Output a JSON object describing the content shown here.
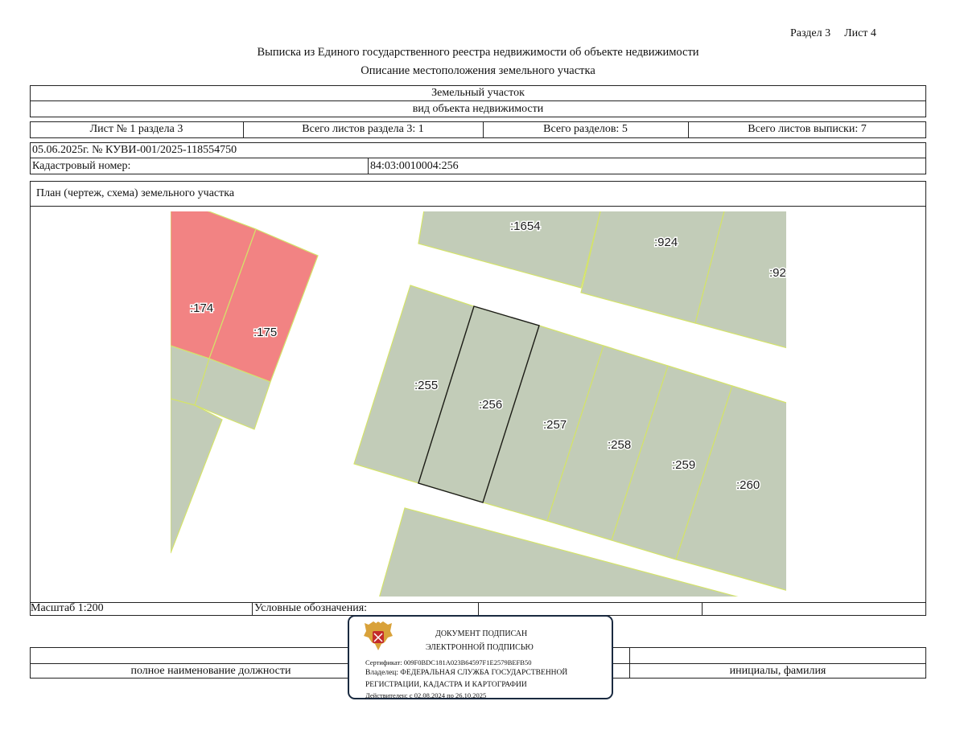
{
  "header": {
    "section": "Раздел 3",
    "sheet": "Лист 4",
    "title": "Выписка из Единого государственного реестра недвижимости об объекте недвижимости",
    "subtitle": "Описание местоположения земельного участка"
  },
  "object": {
    "type": "Земельный участок",
    "type_caption": "вид объекта недвижимости"
  },
  "sheets_row": {
    "sheet_no": "Лист № 1 раздела 3",
    "total_section_sheets": "Всего листов раздела 3: 1",
    "total_sections": "Всего разделов: 5",
    "total_extract_sheets": "Всего листов выписки: 7"
  },
  "record": {
    "date_number": "05.06.2025г. № КУВИ-001/2025-118554750",
    "cadastral_label": "Кадастровый номер:",
    "cadastral_value": "84:03:0010004:256"
  },
  "plan": {
    "title": "План (чертеж, схема) земельного участка",
    "parcels": [
      {
        "label": ":1654",
        "kind": "neighbor"
      },
      {
        "label": ":924",
        "kind": "neighbor"
      },
      {
        "label": ":92",
        "kind": "neighbor"
      },
      {
        "label": ":174",
        "kind": "highlighted"
      },
      {
        "label": ":175",
        "kind": "highlighted"
      },
      {
        "label": ":255",
        "kind": "neighbor"
      },
      {
        "label": ":256",
        "kind": "subject"
      },
      {
        "label": ":257",
        "kind": "neighbor"
      },
      {
        "label": ":258",
        "kind": "neighbor"
      },
      {
        "label": ":259",
        "kind": "neighbor"
      },
      {
        "label": ":260",
        "kind": "neighbor"
      }
    ],
    "colors": {
      "parcel_fill": "#c2ccb8",
      "highlight_fill": "#f28383",
      "boundary": "#d4e36a",
      "subject_boundary": "#1a1a1a"
    }
  },
  "footer": {
    "scale": "Масштаб 1:200",
    "legend": "Условные обозначения:",
    "position_caption": "полное наименование должности",
    "name_caption": "инициалы, фамилия"
  },
  "signature_stamp": {
    "line1": "ДОКУМЕНТ ПОДПИСАН",
    "line2": "ЭЛЕКТРОННОЙ ПОДПИСЬЮ",
    "certificate": "Сертификат: 009F0BDC181A023B64597F1E2579BEFB50",
    "owner1": "Владелец: ФЕДЕРАЛЬНАЯ СЛУЖБА ГОСУДАРСТВЕННОЙ",
    "owner2": "РЕГИСТРАЦИИ, КАДАСТРА И КАРТОГРАФИИ",
    "validity": "Действителен: с 02.08.2024 по 26.10.2025",
    "emblem_icon": "russian-eagle-emblem-icon"
  }
}
